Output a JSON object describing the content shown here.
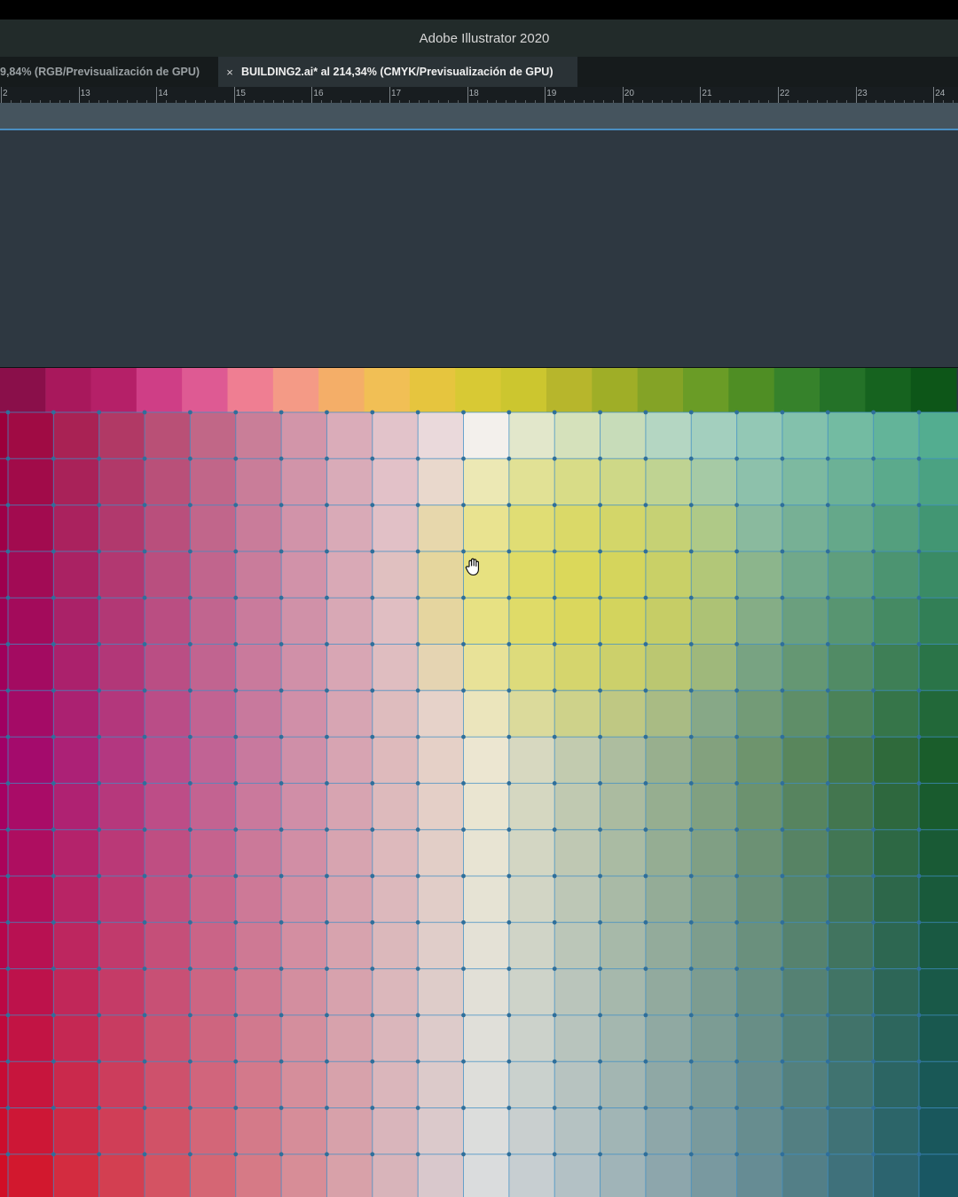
{
  "window": {
    "title": "Adobe Illustrator 2020"
  },
  "tabs": [
    {
      "label": "9,84% (RGB/Previsualización de GPU)",
      "active": false
    },
    {
      "label": "BUILDING2.ai* al 214,34% (CMYK/Previsualización de GPU)",
      "active": true,
      "close_symbol": "×"
    }
  ],
  "ruler": {
    "labels": [
      "2",
      "13",
      "14",
      "15",
      "16",
      "17",
      "18",
      "19",
      "20",
      "21",
      "22",
      "23",
      "24"
    ]
  },
  "swatch_header_colors": [
    "#8a0f4a",
    "#a8185c",
    "#b52068",
    "#cf3e86",
    "#de5a93",
    "#ef7e92",
    "#f49a86",
    "#f4ae68",
    "#f1bf55",
    "#e6c53e",
    "#d8c934",
    "#ccc62f",
    "#b7b62c",
    "#9fae27",
    "#84a326",
    "#6a9c26",
    "#4f8e24",
    "#36822b",
    "#247228",
    "#16631f",
    "#0d5618"
  ],
  "gradient_mesh": {
    "columns": 21,
    "rows": 17,
    "corner_colors": {
      "top_left": "#9c0038",
      "top_center": "#f3f1ee",
      "top_right": "#4fb093",
      "middle_left": "#a10068",
      "middle_center": "#ece6d0",
      "middle_right": "#0e5420",
      "bottom_left": "#d40f22",
      "bottom_center": "#d9dbde",
      "bottom_right": "#0f5060"
    },
    "accent": "#e0d835",
    "grid_line_color": "#3f8fc6",
    "anchor_color": "#2f6f9b"
  },
  "cursor": {
    "icon": "hand-icon"
  }
}
